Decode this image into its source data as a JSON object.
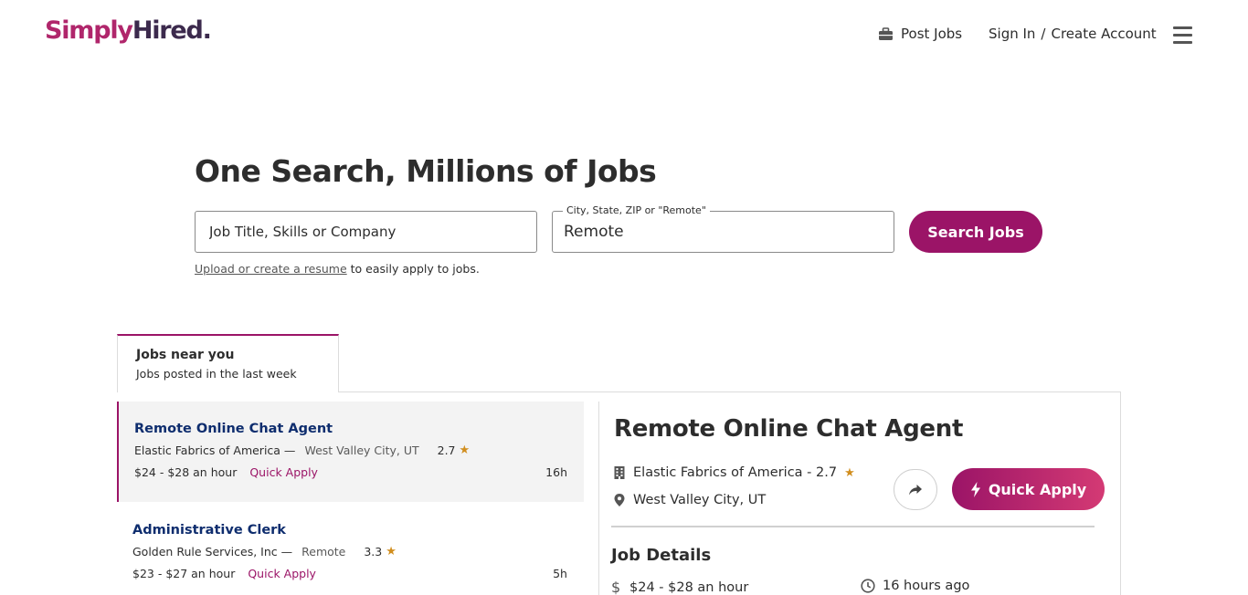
{
  "header": {
    "logo_part1": "Simply",
    "logo_part2": "Hired.",
    "post_jobs": "Post Jobs",
    "sign_in": "Sign In",
    "separator": "/",
    "create_account": "Create Account"
  },
  "hero": {
    "title": "One Search, Millions of Jobs",
    "what_placeholder": "Job Title, Skills or Company",
    "where_label": "City, State, ZIP or \"Remote\"",
    "where_value": "Remote",
    "search_button": "Search Jobs",
    "resume_link": "Upload or create a resume",
    "resume_text": " to easily apply to jobs."
  },
  "tab": {
    "title": "Jobs near you",
    "subtitle": "Jobs posted in the last week"
  },
  "jobs": [
    {
      "title": "Remote Online Chat Agent",
      "company": "Elastic Fabrics of America —",
      "location": "West Valley City, UT",
      "rating": "2.7",
      "pay": "$24 - $28 an hour",
      "quick_apply": "Quick Apply",
      "age": "16h"
    },
    {
      "title": "Administrative Clerk",
      "company": "Golden Rule Services, Inc —",
      "location": "Remote",
      "rating": "3.3",
      "pay": "$23 - $27 an hour",
      "quick_apply": "Quick Apply",
      "age": "5h"
    }
  ],
  "detail": {
    "title": "Remote Online Chat Agent",
    "company": "Elastic Fabrics of America - 2.7",
    "location": "West Valley City, UT",
    "quick_apply": "Quick Apply",
    "details_heading": "Job Details",
    "pay": "$24 - $28 an hour",
    "posted": "16 hours ago"
  },
  "colors": {
    "brand": "#9b1467",
    "job_title": "#0e2d6e",
    "star": "#d18e1e"
  }
}
